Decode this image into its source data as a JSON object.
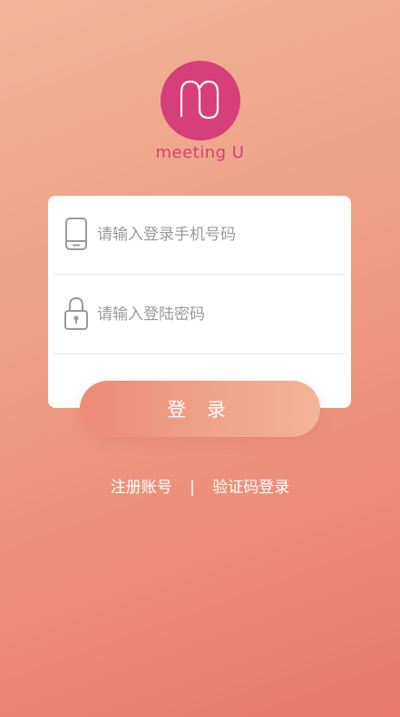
{
  "app": {
    "brand_name": "meeting U",
    "logo_letter": "m",
    "brand_color": "#d63f79"
  },
  "form": {
    "phone_placeholder": "请输入登录手机号码",
    "phone_value": "",
    "phone_icon": "mobile-phone-icon",
    "password_placeholder": "请输入登陆密码",
    "password_value": "",
    "password_icon": "padlock-icon"
  },
  "actions": {
    "login_label": "登 录",
    "register_label": "注册账号",
    "separator": "|",
    "code_login_label": "验证码登录"
  }
}
